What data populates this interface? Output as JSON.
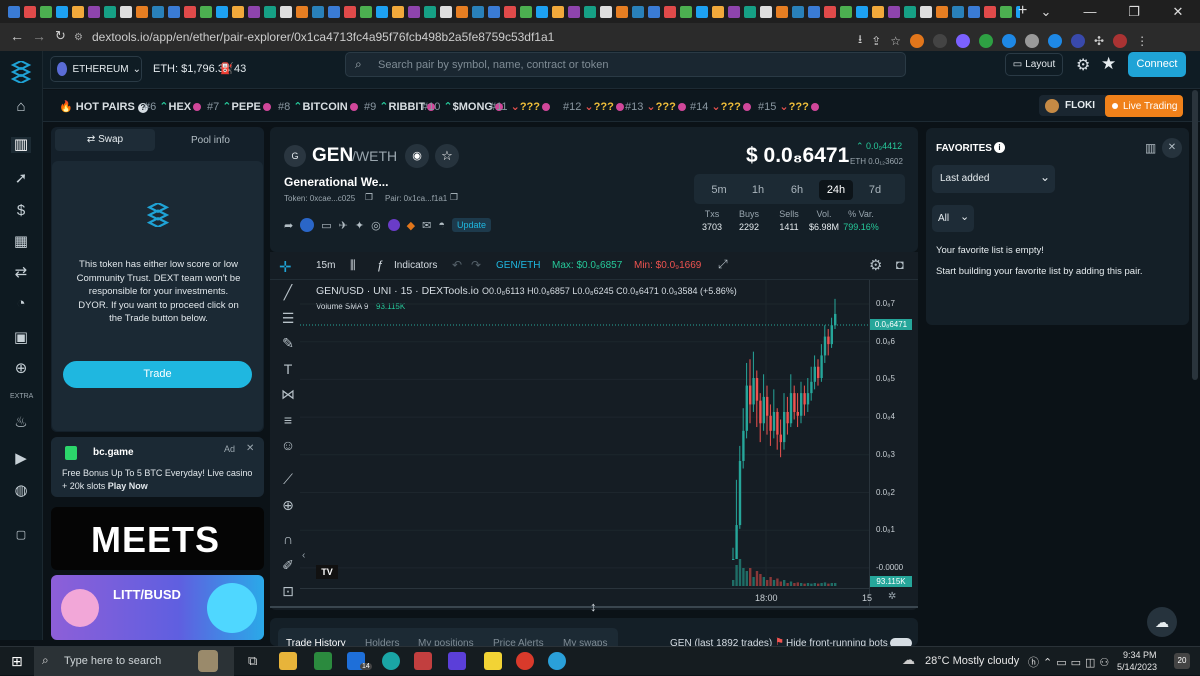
{
  "browser": {
    "url": "dextools.io/app/en/ether/pair-explorer/0x1ca4713fc4a95f76fcb498b2a5fe8759c53df1a1",
    "new_tab": "+",
    "window": {
      "minimize": "—",
      "restore": "❐",
      "close": "✕"
    }
  },
  "header": {
    "network": "ETHEREUM",
    "eth_price": "ETH: $1,796.38",
    "gas": "43",
    "search_placeholder": "Search pair by symbol, name, contract or token",
    "layout_label": "Layout",
    "connect_label": "Connect"
  },
  "hotbar": {
    "title": "HOT PAIRS",
    "pairs": [
      {
        "rank": "#6",
        "symbol": "HEX"
      },
      {
        "rank": "#7",
        "symbol": "PEPE"
      },
      {
        "rank": "#8",
        "symbol": "BITCOIN"
      },
      {
        "rank": "#9",
        "symbol": "RIBBIT"
      },
      {
        "rank": "#10",
        "symbol": "$MONG"
      },
      {
        "rank": "#11",
        "symbol": "???"
      },
      {
        "rank": "#12",
        "symbol": "???"
      },
      {
        "rank": "#13",
        "symbol": "???"
      },
      {
        "rank": "#14",
        "symbol": "???"
      },
      {
        "rank": "#15",
        "symbol": "???"
      }
    ],
    "featured": "FLOKI",
    "live": "Live Trading"
  },
  "sidebar": {
    "extra_label": "EXTRA"
  },
  "left_panel": {
    "tab_swap": "Swap",
    "tab_pool": "Pool info",
    "warning": "This token has either low score or low Community Trust. DEXT team won't be responsible for your investments. DYOR. If you want to proceed click on the Trade button below.",
    "trade_label": "Trade",
    "ad": {
      "name": "bc.game",
      "tag": "Ad",
      "text": "Free Bonus Up To 5 BTC Everyday! Live casino + 20k slots",
      "cta": "Play Now"
    },
    "banner1": "MEETS",
    "banner2": "LITT/BUSD"
  },
  "pair": {
    "badge": "G",
    "symbol": "GEN",
    "quote": "/WETH",
    "name": "Generational We...",
    "token_label": "Token: 0xcae...c025",
    "pair_label": "Pair: 0x1ca...f1a1",
    "update_label": "Update",
    "price": "$ 0.0₈6471",
    "change": "0.0₉4412",
    "price_eth": "ETH 0.0₁₂3602",
    "timeframes": [
      "5m",
      "1h",
      "6h",
      "24h",
      "7d"
    ],
    "active_timeframe": "24h",
    "stats": [
      {
        "label": "Txs",
        "value": "3703"
      },
      {
        "label": "Buys",
        "value": "2292"
      },
      {
        "label": "Sells",
        "value": "1411"
      },
      {
        "label": "Vol.",
        "value": "$6.98M"
      },
      {
        "label": "% Var.",
        "value": "799.16%"
      }
    ]
  },
  "chart_toolbar": {
    "interval": "15m",
    "indicators": "Indicators",
    "pair": "GEN/ETH",
    "max": "Max: $0.0₈6857",
    "min": "Min: $0.0₉1669"
  },
  "chart": {
    "legend": "GEN/USD · UNI · 15 · DEXTools.io",
    "ohlc": "O0.0₈6113 H0.0₈6857 L0.0₈6245 C0.0₈6471 0.0₉3584 (+5.86%)",
    "volume_label": "Volume SMA 9",
    "volume_value": "93.115K",
    "y_labels": [
      "0.0₈7",
      "0.0₈6",
      "0.0₈5",
      "0.0₈4",
      "0.0₈3",
      "0.0₈2",
      "0.0₈1",
      "-0.0000"
    ],
    "last_price_tag": "0.0₈6471",
    "volume_tag": "93.115K",
    "x_labels": [
      "18:00",
      "15"
    ],
    "logo": "TV"
  },
  "bottom_tabs": [
    "Trade History",
    "Holders",
    "My positions",
    "Price Alerts",
    "My swaps"
  ],
  "bottom_info": "GEN (last 1892 trades)",
  "bottom_toggle": "Hide front-running bots",
  "favorites": {
    "title": "FAVORITES",
    "sort": "Last added",
    "filter": "All",
    "empty": "Your favorite list is empty!",
    "hint": "Start building your favorite list by adding this pair."
  },
  "taskbar": {
    "search": "Type here to search",
    "weather": "28°C  Mostly cloudy",
    "time": "9:34 PM",
    "date": "5/14/2023",
    "badge_mail": "14",
    "notif": "20"
  },
  "colors": {
    "accent": "#1fa3d6",
    "green": "#26a69a",
    "red": "#ef5350",
    "orange": "#f0811a"
  }
}
